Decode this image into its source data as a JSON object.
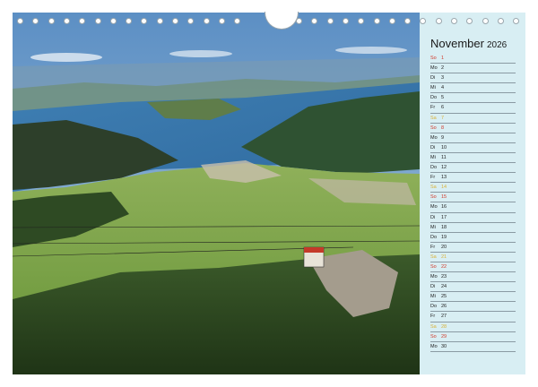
{
  "calendar": {
    "month": "November",
    "year": "2026",
    "days": [
      {
        "dn": "So",
        "d": "1",
        "type": "sun"
      },
      {
        "dn": "Mo",
        "d": "2",
        "type": ""
      },
      {
        "dn": "Di",
        "d": "3",
        "type": ""
      },
      {
        "dn": "Mi",
        "d": "4",
        "type": ""
      },
      {
        "dn": "Do",
        "d": "5",
        "type": ""
      },
      {
        "dn": "Fr",
        "d": "6",
        "type": ""
      },
      {
        "dn": "Sa",
        "d": "7",
        "type": "sat"
      },
      {
        "dn": "So",
        "d": "8",
        "type": "sun"
      },
      {
        "dn": "Mo",
        "d": "9",
        "type": ""
      },
      {
        "dn": "Di",
        "d": "10",
        "type": ""
      },
      {
        "dn": "Mi",
        "d": "11",
        "type": ""
      },
      {
        "dn": "Do",
        "d": "12",
        "type": ""
      },
      {
        "dn": "Fr",
        "d": "13",
        "type": ""
      },
      {
        "dn": "Sa",
        "d": "14",
        "type": "sat"
      },
      {
        "dn": "So",
        "d": "15",
        "type": "sun"
      },
      {
        "dn": "Mo",
        "d": "16",
        "type": ""
      },
      {
        "dn": "Di",
        "d": "17",
        "type": ""
      },
      {
        "dn": "Mi",
        "d": "18",
        "type": ""
      },
      {
        "dn": "Do",
        "d": "19",
        "type": ""
      },
      {
        "dn": "Fr",
        "d": "20",
        "type": ""
      },
      {
        "dn": "Sa",
        "d": "21",
        "type": "sat"
      },
      {
        "dn": "So",
        "d": "22",
        "type": "sun"
      },
      {
        "dn": "Mo",
        "d": "23",
        "type": ""
      },
      {
        "dn": "Di",
        "d": "24",
        "type": ""
      },
      {
        "dn": "Mi",
        "d": "25",
        "type": ""
      },
      {
        "dn": "Do",
        "d": "26",
        "type": ""
      },
      {
        "dn": "Fr",
        "d": "27",
        "type": ""
      },
      {
        "dn": "Sa",
        "d": "28",
        "type": "sat"
      },
      {
        "dn": "So",
        "d": "29",
        "type": "sun"
      },
      {
        "dn": "Mo",
        "d": "30",
        "type": ""
      }
    ]
  },
  "colors": {
    "panel": "#d8eef3",
    "sunday": "#d23a2a",
    "saturday": "#d9b23a"
  }
}
